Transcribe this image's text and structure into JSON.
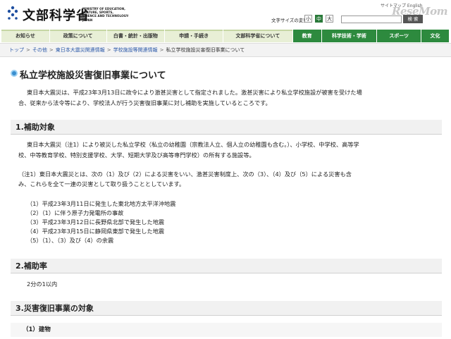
{
  "header": {
    "logo_text": "文部科学省",
    "logo_sub": [
      "MINISTRY OF EDUCATION,",
      "CULTURE, SPORTS,",
      "SCIENCE AND TECHNOLOGY-JAPAN"
    ],
    "font_size_label": "文字サイズの変更",
    "font_size_small": "小",
    "font_size_mid": "中",
    "font_size_large": "大",
    "search_placeholder": "",
    "search_button": "検 索",
    "top_links": "サイトマップ  English",
    "watermark": "ReseMom",
    "colors": {
      "accent_green": "#2d8a3e",
      "nav_light": "#e8efd6",
      "bullet_blue": "#3a8fd0"
    }
  },
  "nav": {
    "items": [
      {
        "label": "お知らせ",
        "style": "light"
      },
      {
        "label": "政策について",
        "style": "light"
      },
      {
        "label": "白書・統計・出版物",
        "style": "light"
      },
      {
        "label": "申請・手続き",
        "style": "light"
      },
      {
        "label": "文部科学省について",
        "style": "light"
      },
      {
        "label": "教育",
        "style": "dark"
      },
      {
        "label": "科学技術・学術",
        "style": "dark"
      },
      {
        "label": "スポーツ",
        "style": "dark"
      },
      {
        "label": "文化",
        "style": "dark"
      }
    ]
  },
  "breadcrumb": {
    "items": [
      "トップ",
      "その他",
      "東日本大震災関連情報",
      "学校施設等関連情報",
      "私立学校施設災害復旧事業について"
    ],
    "separator": ">"
  },
  "main": {
    "title": "私立学校施設災害復旧事業について",
    "intro_lines": [
      "東日本大震災は、平成23年3月13日に政令により激甚災害として指定されました。激甚災害により私立学校施設が被害を受けた場",
      "合、従来から法令等により、学校法人が行う災害復旧事業に対し補助を実施しているところです。"
    ],
    "sections": [
      {
        "heading": "1.補助対象",
        "para1": [
          "東日本大震災（注1）により被災した私立学校（私立の幼稚園（宗教法人立、個人立の幼稚園も含む。）、小学校、中学校、高等学",
          "校、中等教育学校、特別支援学校、大学、短期大学及び高等専門学校）の所有する施設等。"
        ],
        "note": [
          "（注1）東日本大震災とは、次の（1）及び（2）による災害をいい、激甚災害制度上、次の（3）、（4）及び（5）による災害も含",
          "み、これらを全て一連の災害として取り扱うこととしています。"
        ],
        "list": [
          "（1）平成23年3月11日に発生した東北地方太平洋沖地震",
          "（2）（1）に伴う原子力発電所の事故",
          "（3）平成23年3月12日に長野県北部で発生した地震",
          "（4）平成23年3月15日に静岡県東部で発生した地震",
          "（5）（1）、（3）及び（4）の余震"
        ]
      },
      {
        "heading": "2.補助率",
        "text": "2分の1以内"
      },
      {
        "heading": "3.災害復旧事業の対象",
        "sub": "（1）建物"
      }
    ]
  }
}
